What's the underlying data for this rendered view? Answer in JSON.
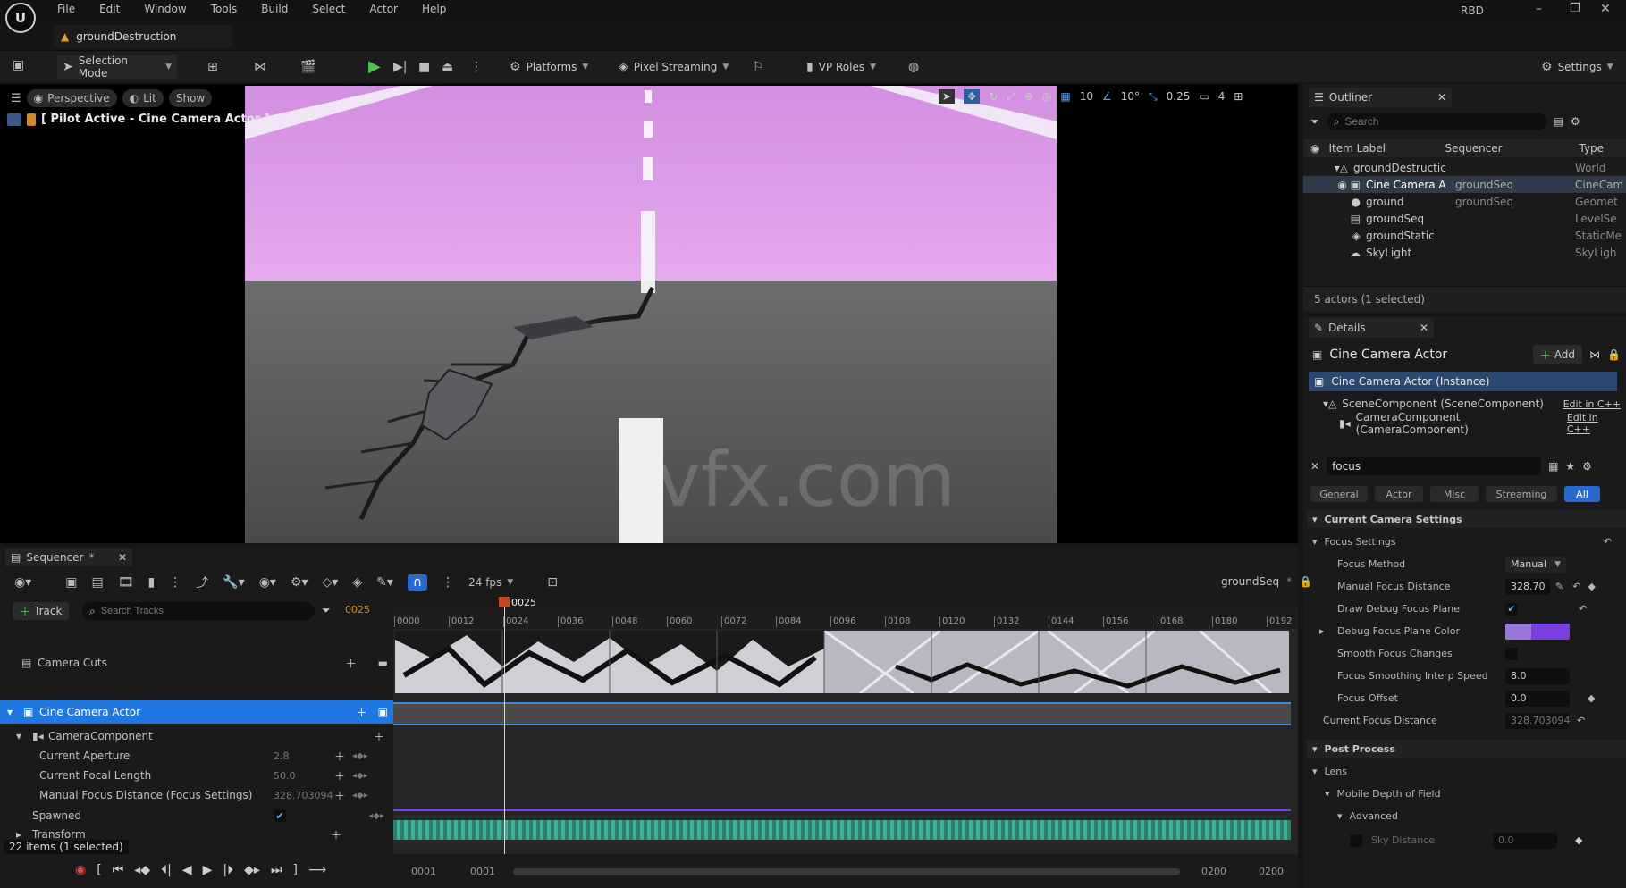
{
  "menu": {
    "items": [
      "File",
      "Edit",
      "Window",
      "Tools",
      "Build",
      "Select",
      "Actor",
      "Help"
    ],
    "user": "RBD"
  },
  "level_tab": "groundDestruction",
  "toolbar": {
    "selection_mode": "Selection Mode",
    "platforms": "Platforms",
    "pixel_streaming": "Pixel Streaming",
    "vp_roles": "VP Roles",
    "settings": "Settings"
  },
  "viewport": {
    "perspective": "Perspective",
    "lit": "Lit",
    "show": "Show",
    "pilot_label": "[ Pilot Active - Cine Camera Actor ]",
    "grid_snap": "10",
    "rot_snap": "10°",
    "scale_snap": "0.25",
    "cam_speed": "4",
    "watermark": "vfx.com"
  },
  "outliner": {
    "title": "Outliner",
    "search_placeholder": "Search",
    "columns": {
      "label": "Item Label",
      "sequencer": "Sequencer",
      "type": "Type"
    },
    "rows": [
      {
        "name": "groundDestructic",
        "seq": "",
        "type": "World"
      },
      {
        "name": "Cine Camera A",
        "seq": "groundSeq",
        "type": "CineCam"
      },
      {
        "name": "ground",
        "seq": "groundSeq",
        "type": "Geomet"
      },
      {
        "name": "groundSeq",
        "seq": "",
        "type": "LevelSe"
      },
      {
        "name": "groundStatic",
        "seq": "",
        "type": "StaticMe"
      },
      {
        "name": "SkyLight",
        "seq": "",
        "type": "SkyLigh"
      }
    ],
    "status": "5 actors (1 selected)"
  },
  "details": {
    "title": "Details",
    "actor_name": "Cine Camera Actor",
    "add_label": "Add",
    "instance_label": "Cine Camera Actor (Instance)",
    "components": [
      {
        "name": "SceneComponent (SceneComponent)",
        "edit": "Edit in C++"
      },
      {
        "name": "CameraComponent (CameraComponent)",
        "edit": "Edit in C++"
      }
    ],
    "search_value": "focus",
    "categories": [
      "General",
      "Actor",
      "Misc",
      "Streaming",
      "All"
    ],
    "section_current_camera": "Current Camera Settings",
    "focus_settings": "Focus Settings",
    "props": {
      "focus_method": {
        "label": "Focus Method",
        "value": "Manual"
      },
      "manual_focus_distance": {
        "label": "Manual Focus Distance",
        "value": "328.70"
      },
      "draw_debug_focus_plane": {
        "label": "Draw Debug Focus Plane"
      },
      "debug_focus_plane_color": {
        "label": "Debug Focus Plane Color"
      },
      "smooth_focus_changes": {
        "label": "Smooth Focus Changes"
      },
      "focus_smoothing_interp_speed": {
        "label": "Focus Smoothing Interp Speed",
        "value": "8.0"
      },
      "focus_offset": {
        "label": "Focus Offset",
        "value": "0.0"
      },
      "current_focus_distance": {
        "label": "Current Focus Distance",
        "value": "328.703094"
      }
    },
    "post_process": "Post Process",
    "lens": "Lens",
    "mobile_dof": "Mobile Depth of Field",
    "advanced": "Advanced",
    "sky_distance": {
      "label": "Sky Distance",
      "value": "0.0"
    },
    "debug_color": "#7a3fe0"
  },
  "sequencer": {
    "tab": "Sequencer",
    "fps": "24 fps",
    "seq_name": "groundSeq",
    "track_btn": "Track",
    "search_placeholder": "Search Tracks",
    "current_frame": "0025",
    "playhead_label": "0025",
    "ticks": [
      "0000",
      "0012",
      "0024",
      "0036",
      "0048",
      "0060",
      "0072",
      "0084",
      "0096",
      "0108",
      "0120",
      "0132",
      "0144",
      "0156",
      "0168",
      "0180",
      "0192"
    ],
    "tracks": {
      "camera_cuts": "Camera Cuts",
      "cine_camera_actor": "Cine Camera Actor",
      "camera_component": "CameraComponent",
      "current_aperture": {
        "label": "Current Aperture",
        "value": "2.8"
      },
      "current_focal_length": {
        "label": "Current Focal Length",
        "value": "50.0"
      },
      "manual_focus_distance": {
        "label": "Manual Focus Distance (Focus Settings)",
        "value": "328.703094"
      },
      "spawned": "Spawned",
      "transform": "Transform"
    },
    "status": "22 items (1 selected)",
    "range": {
      "start_a": "0001",
      "start_b": "0001",
      "end_a": "0200",
      "end_b": "0200"
    }
  }
}
